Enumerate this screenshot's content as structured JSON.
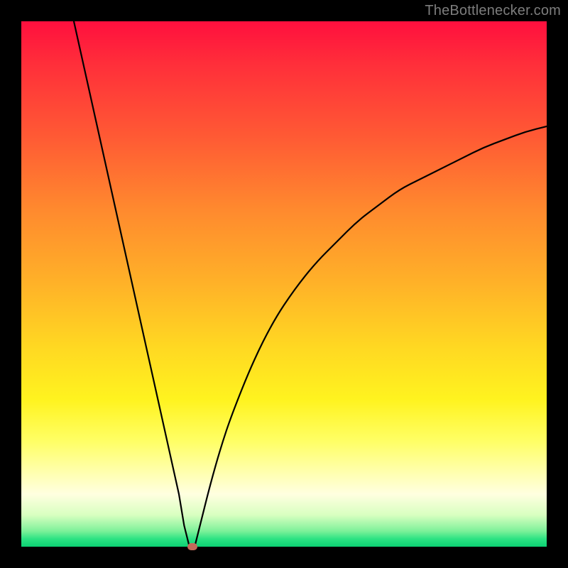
{
  "watermark": "TheBottlenecker.com",
  "chart_data": {
    "type": "line",
    "title": "",
    "xlabel": "",
    "ylabel": "",
    "xlim": [
      0,
      100
    ],
    "ylim": [
      0,
      100
    ],
    "legend": false,
    "grid": false,
    "background_gradient": {
      "from": "#ff0f3e",
      "to": "#0bd173",
      "meaning_top": "red = high bottleneck",
      "meaning_bottom": "green = no bottleneck"
    },
    "series": [
      {
        "name": "bottleneck-curve",
        "color": "#000000",
        "x": [
          10,
          12,
          14,
          16,
          18,
          20,
          22,
          24,
          26,
          28,
          30,
          31,
          32,
          33,
          34,
          36,
          38,
          40,
          44,
          48,
          52,
          56,
          60,
          64,
          68,
          72,
          76,
          80,
          84,
          88,
          92,
          96,
          100
        ],
        "y": [
          100,
          91,
          82,
          73,
          64,
          55,
          46,
          37,
          28,
          19,
          10,
          4,
          0,
          0,
          4,
          12,
          19,
          25,
          35,
          43,
          49,
          54,
          58,
          62,
          65,
          68,
          70,
          72,
          74,
          76,
          77.5,
          79,
          80
        ]
      }
    ],
    "marker": {
      "name": "optimal-point",
      "x": 32.5,
      "y": 0,
      "color": "#c36a5a"
    }
  }
}
